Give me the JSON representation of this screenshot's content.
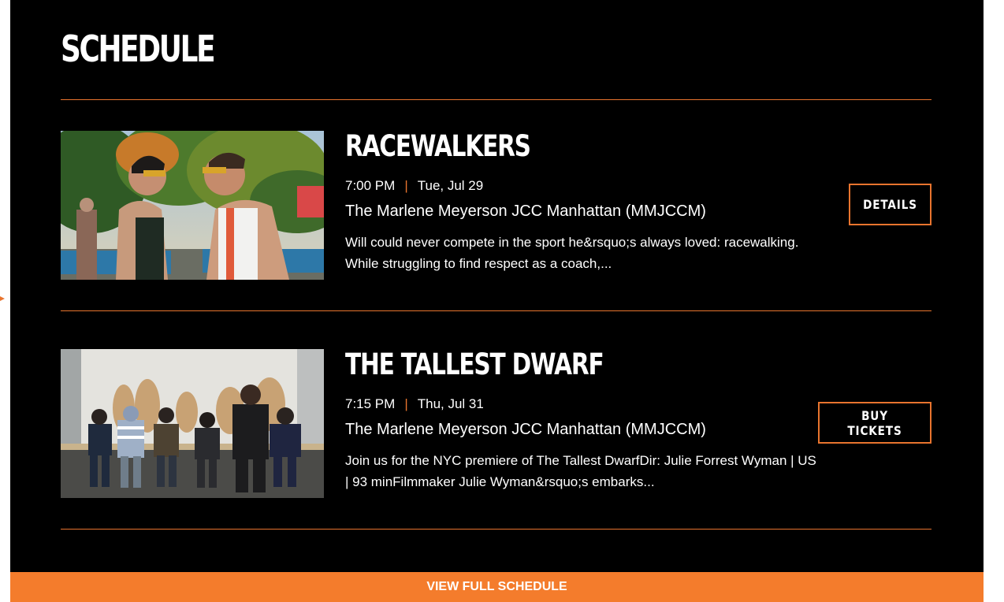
{
  "section": {
    "title": "SCHEDULE"
  },
  "events": [
    {
      "title": "RACEWALKERS",
      "time": "7:00 PM",
      "separator": "|",
      "date": "Tue, Jul 29",
      "venue": "The Marlene Meyerson JCC Manhattan (MMJCCM)",
      "description": "Will could never compete in the sport he&rsquo;s always loved: racewalking. While struggling to find respect as a coach,...",
      "button_label": "DETAILS",
      "image_icon": "film-still-image"
    },
    {
      "title": "THE TALLEST DWARF",
      "time": "7:15 PM",
      "separator": "|",
      "date": "Thu, Jul 31",
      "venue": "The Marlene Meyerson JCC Manhattan (MMJCCM)",
      "description": "Join us for the NYC premiere of The Tallest DwarfDir: Julie Forrest Wyman | US | 93 minFilmmaker Julie Wyman&rsquo;s embarks...",
      "button_label": "BUY TICKETS",
      "image_icon": "film-still-image"
    }
  ],
  "footer": {
    "view_all_label": "VIEW FULL SCHEDULE"
  },
  "colors": {
    "background": "#000000",
    "accent": "#e8742e",
    "footer_bar": "#f47c2c",
    "text": "#ffffff"
  }
}
